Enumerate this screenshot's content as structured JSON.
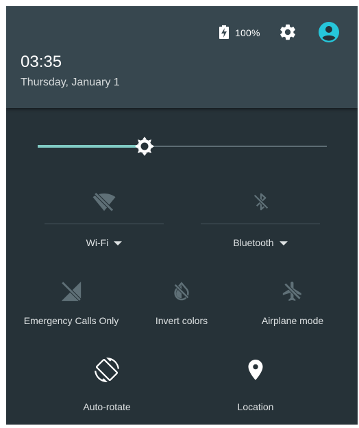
{
  "status": {
    "battery_text": "100%",
    "icons": [
      "battery-charging-icon",
      "gear-icon",
      "account-circle-icon"
    ]
  },
  "header": {
    "time": "03:35",
    "date": "Thursday, January 1"
  },
  "brightness": {
    "level": 0.37
  },
  "tiles": {
    "wifi": {
      "label": "Wi-Fi",
      "icon": "wifi-off-icon"
    },
    "bluetooth": {
      "label": "Bluetooth",
      "icon": "bluetooth-disabled-icon"
    },
    "emergency": {
      "label": "Emergency Calls Only",
      "icon": "signal-off-icon"
    },
    "invert": {
      "label": "Invert colors",
      "icon": "invert-colors-off-icon"
    },
    "airplane": {
      "label": "Airplane mode",
      "icon": "airplane-off-icon"
    },
    "autorotate": {
      "label": "Auto-rotate",
      "icon": "screen-rotation-icon"
    },
    "location": {
      "label": "Location",
      "icon": "location-pin-icon"
    }
  },
  "colors": {
    "panel": "#263238",
    "header": "#37474f",
    "accent": "#80cbc4",
    "avatar": "#26c6da",
    "disabled_icon": "#5f7077"
  }
}
